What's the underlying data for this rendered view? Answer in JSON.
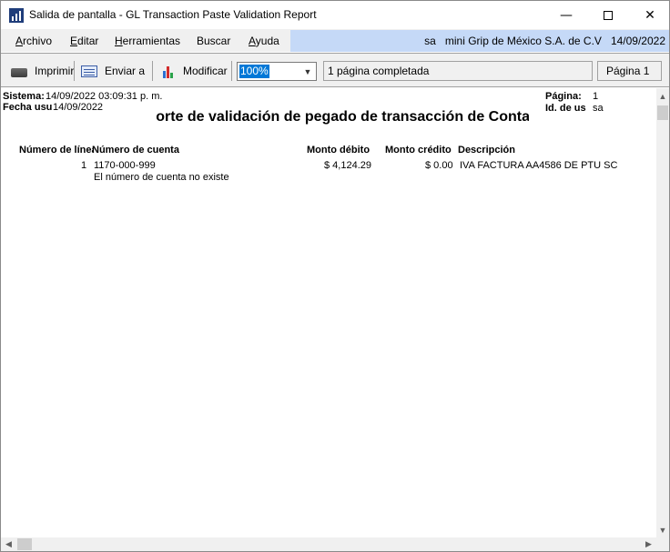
{
  "window": {
    "title": "Salida de pantalla - GL Transaction Paste Validation Report",
    "minimize_glyph": "—",
    "close_glyph": "✕"
  },
  "menu": {
    "items": [
      {
        "label": "Archivo",
        "accel": "A",
        "rest": "rchivo"
      },
      {
        "label": "Editar",
        "accel": "E",
        "rest": "ditar"
      },
      {
        "label": "Herramientas",
        "accel": "H",
        "rest": "erramientas"
      },
      {
        "label": "Buscar",
        "accel": "",
        "rest": "Buscar"
      },
      {
        "label": "Ayuda",
        "accel": "A",
        "rest": "yuda"
      }
    ],
    "user": "sa",
    "company": "mini Grip de México S.A. de C.V",
    "date": "14/09/2022"
  },
  "toolbar": {
    "print_label": "Imprimir",
    "send_label": "Enviar a",
    "modify_label": "Modificar",
    "zoom_value": "100%",
    "pages_status": "1 página completada",
    "page_label": "Página 1"
  },
  "report": {
    "system_label": "Sistema:",
    "system_value": "14/09/2022 03:09:31 p. m.",
    "user_date_label": "Fecha usu",
    "user_date_value": "14/09/2022",
    "page_label": "Página:",
    "page_value": "1",
    "user_id_label": "Id. de us",
    "user_id_value": "sa",
    "title": "Reporte de validación de pegado de transacción de Contabilidad",
    "columns": {
      "line_number": "Número de línea",
      "account_number": "Número de cuenta",
      "debit": "Monto débito",
      "credit": "Monto crédito",
      "description": "Descripción"
    },
    "rows": [
      {
        "line": "1",
        "account": "1170-000-999",
        "error": "El número de cuenta no existe",
        "debit": "$ 4,124.29",
        "credit": "$ 0.00",
        "description": "IVA FACTURA AA4586 DE PTU SC"
      }
    ]
  },
  "colors": {
    "menu_highlight": "#c5d9f7",
    "zoom_selection": "#0078d7",
    "chrome": "#f0f0f0"
  }
}
